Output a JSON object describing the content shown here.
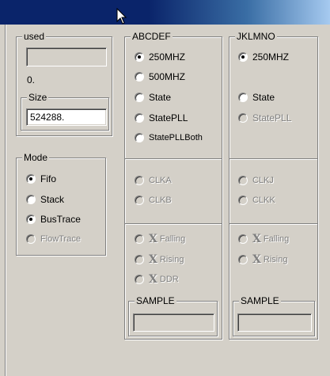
{
  "used_group": {
    "title": "used",
    "value": "",
    "count": "0."
  },
  "size_group": {
    "title": "Size",
    "value": "524288."
  },
  "mode_group": {
    "title": "Mode",
    "options": [
      {
        "label": "Fifo",
        "checked": true,
        "enabled": true
      },
      {
        "label": "Stack",
        "checked": false,
        "enabled": true
      },
      {
        "label": "BusTrace",
        "checked": true,
        "enabled": true
      },
      {
        "label": "FlowTrace",
        "checked": false,
        "enabled": false
      }
    ]
  },
  "abcdef": {
    "title": "ABCDEF",
    "clock_options": [
      {
        "label": "250MHZ",
        "checked": true,
        "enabled": true
      },
      {
        "label": "500MHZ",
        "checked": false,
        "enabled": true
      },
      {
        "label": "State",
        "checked": false,
        "enabled": true
      },
      {
        "label": "StatePLL",
        "checked": false,
        "enabled": true
      },
      {
        "label": "StatePLLBoth",
        "checked": false,
        "enabled": true
      }
    ],
    "clk_options": [
      {
        "label": "CLKA",
        "enabled": false
      },
      {
        "label": "CLKB",
        "enabled": false
      }
    ],
    "edge_options": [
      {
        "label": "Falling",
        "enabled": false
      },
      {
        "label": "Rising",
        "enabled": false
      },
      {
        "label": "DDR",
        "enabled": false
      }
    ],
    "sample": {
      "title": "SAMPLE",
      "value": ""
    }
  },
  "jklmno": {
    "title": "JKLMNO",
    "clock_options": [
      {
        "label": "250MHZ",
        "checked": true,
        "enabled": true
      },
      {
        "label": "State",
        "checked": false,
        "enabled": true
      },
      {
        "label": "StatePLL",
        "checked": false,
        "enabled": false
      }
    ],
    "clk_options": [
      {
        "label": "CLKJ",
        "enabled": false
      },
      {
        "label": "CLKK",
        "enabled": false
      }
    ],
    "edge_options": [
      {
        "label": "Falling",
        "enabled": false
      },
      {
        "label": "Rising",
        "enabled": false
      }
    ],
    "sample": {
      "title": "SAMPLE",
      "value": ""
    }
  },
  "icons": {
    "cursor": "arrow-cursor-icon",
    "edge": "x-edge-icon"
  },
  "colors": {
    "face": "#d4d0c8",
    "titlebar": "#0a246a",
    "disabled": "#808080"
  }
}
